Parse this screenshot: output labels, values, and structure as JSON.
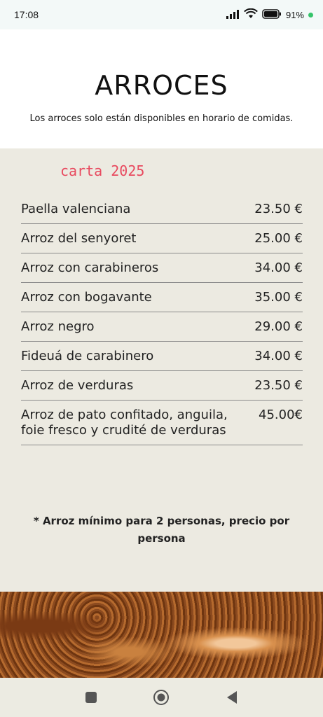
{
  "status_bar": {
    "time": "17:08",
    "battery": "91%"
  },
  "header": {
    "title": "ARROCES",
    "subtitle": "Los arroces solo están disponibles en horario de comidas."
  },
  "menu": {
    "carta_label": "carta 2025",
    "items": [
      {
        "name": "Paella valenciana",
        "price": "23.50 €"
      },
      {
        "name": "Arroz del senyoret",
        "price": "25.00 €"
      },
      {
        "name": "Arroz con carabineros",
        "price": "34.00 €"
      },
      {
        "name": "Arroz con bogavante",
        "price": "35.00 €"
      },
      {
        "name": "Arroz negro",
        "price": "29.00 €"
      },
      {
        "name": "Fideuá de carabinero",
        "price": "34.00 €"
      },
      {
        "name": "Arroz de verduras",
        "price": "23.50 €"
      },
      {
        "name": "Arroz de pato confitado, anguila, foie fresco y crudité de verduras",
        "price": "45.00€"
      }
    ],
    "note": "* Arroz mínimo para 2 personas, precio por persona"
  },
  "colors": {
    "menu_background": "#eceae1",
    "carta_accent": "#e84a5f"
  },
  "icons": {
    "signal": "signal-icon",
    "wifi": "wifi-icon",
    "battery": "battery-icon",
    "nav_recents": "square-icon",
    "nav_home": "home-circle-icon",
    "nav_back": "back-triangle-icon"
  }
}
